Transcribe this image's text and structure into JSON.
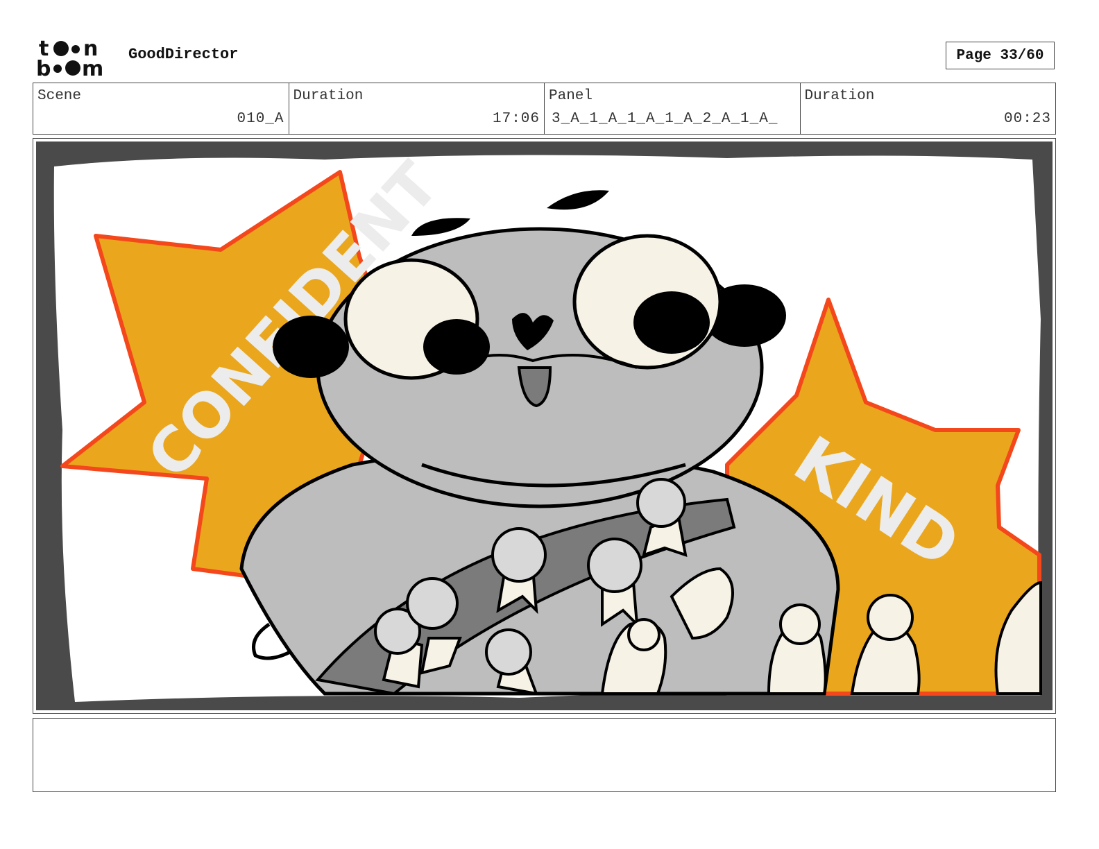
{
  "header": {
    "logo": "toon boom",
    "app_title": "GoodDirector",
    "page": "Page 33/60"
  },
  "info": {
    "scene_label": "Scene",
    "scene_value": "010_A",
    "duration_label": "Duration",
    "duration_value": "17:06",
    "panel_label": "Panel",
    "panel_value": "3_A_1_A_1_A_1_A_2_A_1_A_",
    "panel_duration_label": "Duration",
    "panel_duration_value": "00:23"
  },
  "panel": {
    "word_left": "CONFIDENT",
    "word_right": "KIND",
    "colors": {
      "burst": "#eaa71d",
      "burst_outline": "#f4471c",
      "character": "#bdbdbd",
      "sash": "#7b7b7b",
      "frame": "#4a4a4a"
    }
  },
  "notes": {
    "text": ""
  }
}
